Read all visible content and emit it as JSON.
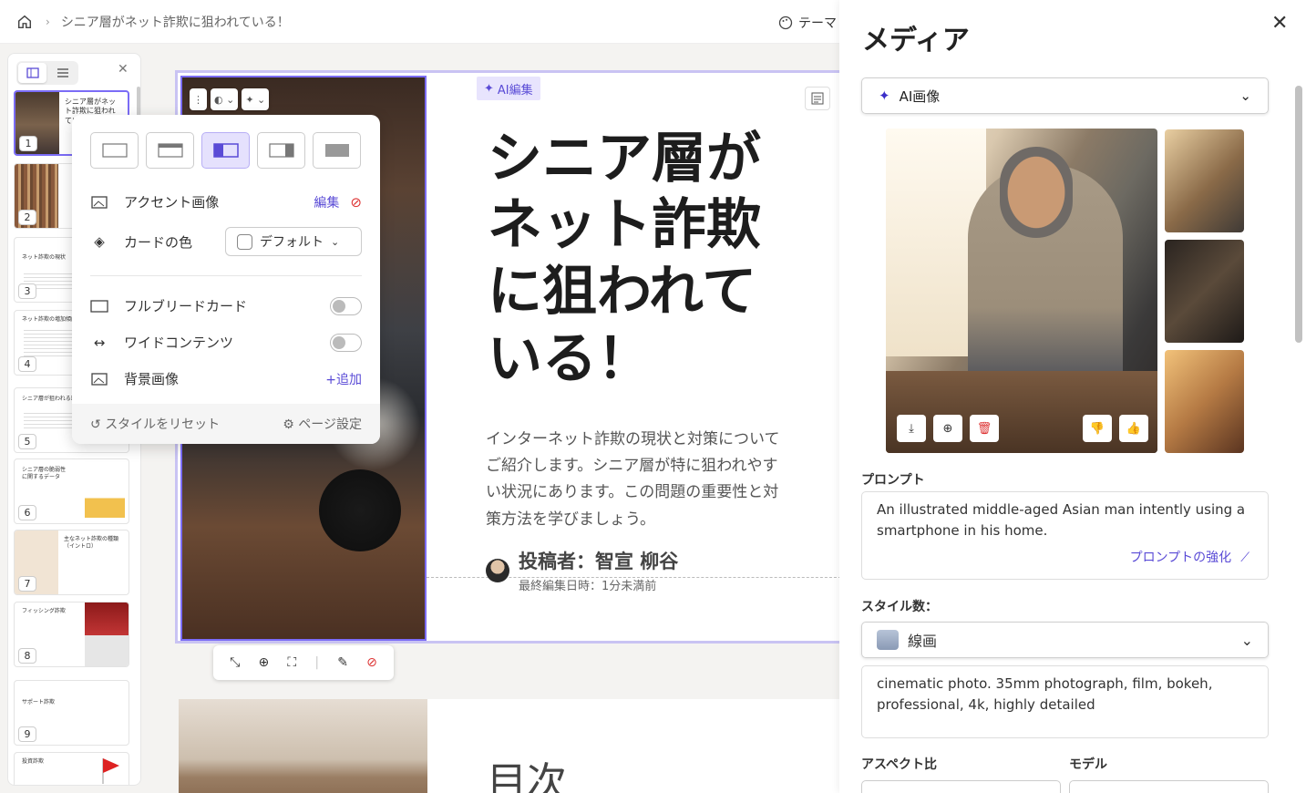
{
  "topbar": {
    "breadcrumb": "シニア層がネット詐欺に狙われている！",
    "theme_label": "テーマ"
  },
  "slides_panel": {
    "thumbs": [
      {
        "num": "1",
        "title": "シニア層がネット詐欺に狙われている！"
      },
      {
        "num": "2",
        "title": ""
      },
      {
        "num": "3",
        "title": "ネット詐欺の現状"
      },
      {
        "num": "4",
        "title": "ネット詐欺の増加傾向"
      },
      {
        "num": "5",
        "title": "シニア層が狙われる理由"
      },
      {
        "num": "6",
        "title": "シニア層の脆弱性に関するデータ"
      },
      {
        "num": "7",
        "title": "主なネット詐欺の種類（イントロ）"
      },
      {
        "num": "8",
        "title": "フィッシング詐欺"
      },
      {
        "num": "9",
        "title": "サポート詐欺"
      },
      {
        "num": "",
        "title": "投資詐欺"
      }
    ]
  },
  "slide": {
    "ai_edit": "AI編集",
    "title": "シニア層がネット詐欺に狙われている！",
    "body": "インターネット詐欺の現状と対策についてご紹介します。シニア層が特に狙われやすい状況にあります。この問題の重要性と対策方法を学びましょう。",
    "author": "投稿者：智宣 柳谷",
    "edited": "最終編集日時：1分未満前"
  },
  "slide2": {
    "heading": "目次"
  },
  "popover": {
    "accent_image": "アクセント画像",
    "edit": "編集",
    "card_color": "カードの色",
    "default": "デフォルト",
    "full_bleed": "フルブリードカード",
    "wide_content": "ワイドコンテンツ",
    "bg_image": "背景画像",
    "add": "+追加",
    "reset": "スタイルをリセット",
    "page_settings": "ページ設定"
  },
  "media": {
    "title": "メディア",
    "source": "AI画像",
    "prompt_label": "プロンプト",
    "prompt": "An illustrated middle-aged Asian man intently using a smartphone in his home.",
    "enhance": "プロンプトの強化",
    "style_label": "スタイル数：",
    "style_value": "線画",
    "style_prompt": "cinematic photo. 35mm photograph, film, bokeh, professional, 4k, highly detailed",
    "aspect_label": "アスペクト比",
    "model_label": "モデル"
  },
  "colors": {
    "accent": "#5a4bd6",
    "selection": "#7b6cf6"
  }
}
